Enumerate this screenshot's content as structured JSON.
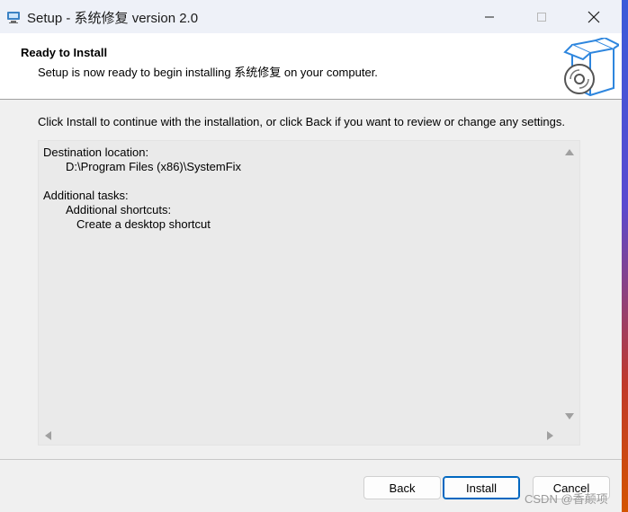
{
  "window": {
    "title": "Setup - 系统修复 version 2.0",
    "buttons": {
      "minimize": "minimize",
      "maximize": "maximize",
      "close": "close"
    }
  },
  "header": {
    "title": "Ready to Install",
    "subtitle": "Setup is now ready to begin installing 系统修复 on your computer."
  },
  "body": {
    "intro": "Click Install to continue with the installation, or click Back if you want to review or change any settings.",
    "memo": [
      "Destination location:",
      "D:\\Program Files (x86)\\SystemFix",
      "Additional tasks:",
      "Additional shortcuts:",
      "Create a desktop shortcut"
    ]
  },
  "footer": {
    "back_label": "Back",
    "install_label": "Install",
    "cancel_label": "Cancel"
  },
  "watermark": "CSDN @香颠项",
  "colors": {
    "accent": "#0067c0",
    "titlebar": "#eef1f8",
    "panel": "#f0f0f0",
    "memo_bg": "#eaeaea"
  },
  "icons": [
    "setup-app-icon",
    "minimize-icon",
    "maximize-icon",
    "close-icon",
    "install-box-disc-icon",
    "scroll-up-icon",
    "scroll-down-icon",
    "scroll-left-icon",
    "scroll-right-icon"
  ]
}
